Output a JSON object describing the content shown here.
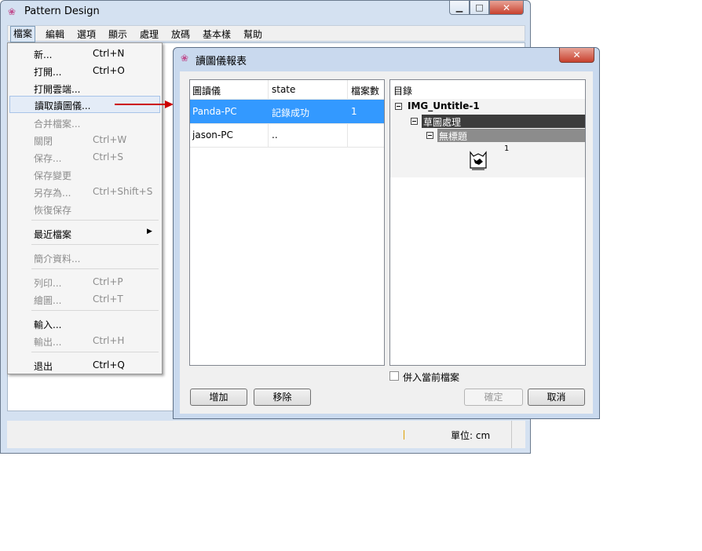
{
  "main_window": {
    "title": "Pattern Design",
    "menubar": [
      "檔案",
      "編輯",
      "選項",
      "顯示",
      "處理",
      "放碼",
      "基本樣",
      "幫助"
    ],
    "status": {
      "unit": "單位: cm"
    }
  },
  "file_menu": {
    "items": [
      {
        "label": "新...",
        "shortcut": "Ctrl+N"
      },
      {
        "label": "打開...",
        "shortcut": "Ctrl+O"
      },
      {
        "label": "打開雲端...",
        "shortcut": ""
      },
      {
        "label": "讀取讀圖儀...",
        "shortcut": ""
      },
      {
        "label": "合并檔案...",
        "shortcut": ""
      },
      {
        "label": "關閉",
        "shortcut": "Ctrl+W"
      },
      {
        "label": "保存...",
        "shortcut": "Ctrl+S"
      },
      {
        "label": "保存變更",
        "shortcut": ""
      },
      {
        "label": "另存為...",
        "shortcut": "Ctrl+Shift+S"
      },
      {
        "label": "恢復保存",
        "shortcut": ""
      },
      {
        "label": "最近檔案",
        "shortcut": ""
      },
      {
        "label": "簡介資料...",
        "shortcut": ""
      },
      {
        "label": "列印...",
        "shortcut": "Ctrl+P"
      },
      {
        "label": "繪圖...",
        "shortcut": "Ctrl+T"
      },
      {
        "label": "輸入...",
        "shortcut": ""
      },
      {
        "label": "輸出...",
        "shortcut": "Ctrl+H"
      },
      {
        "label": "退出",
        "shortcut": "Ctrl+Q"
      }
    ]
  },
  "dialog": {
    "title": "讀圖儀報表",
    "table": {
      "headers": [
        "圖讀儀",
        "state",
        "檔案數"
      ],
      "rows": [
        {
          "device": "Panda-PC",
          "state": "記錄成功",
          "count": "1"
        },
        {
          "device": "jason-PC",
          "state": "..",
          "count": ""
        }
      ]
    },
    "tree": {
      "header": "目錄",
      "root": "IMG_Untitle-1",
      "level1": "草圖處理",
      "level2": "無標題",
      "thumb_count": "1"
    },
    "merge_label": "併入當前檔案",
    "buttons": {
      "add": "增加",
      "remove": "移除",
      "ok": "確定",
      "cancel": "取消"
    }
  },
  "colors": {
    "selection": "#3399ff",
    "arrow": "#cc0000",
    "close": "#c8412e"
  }
}
